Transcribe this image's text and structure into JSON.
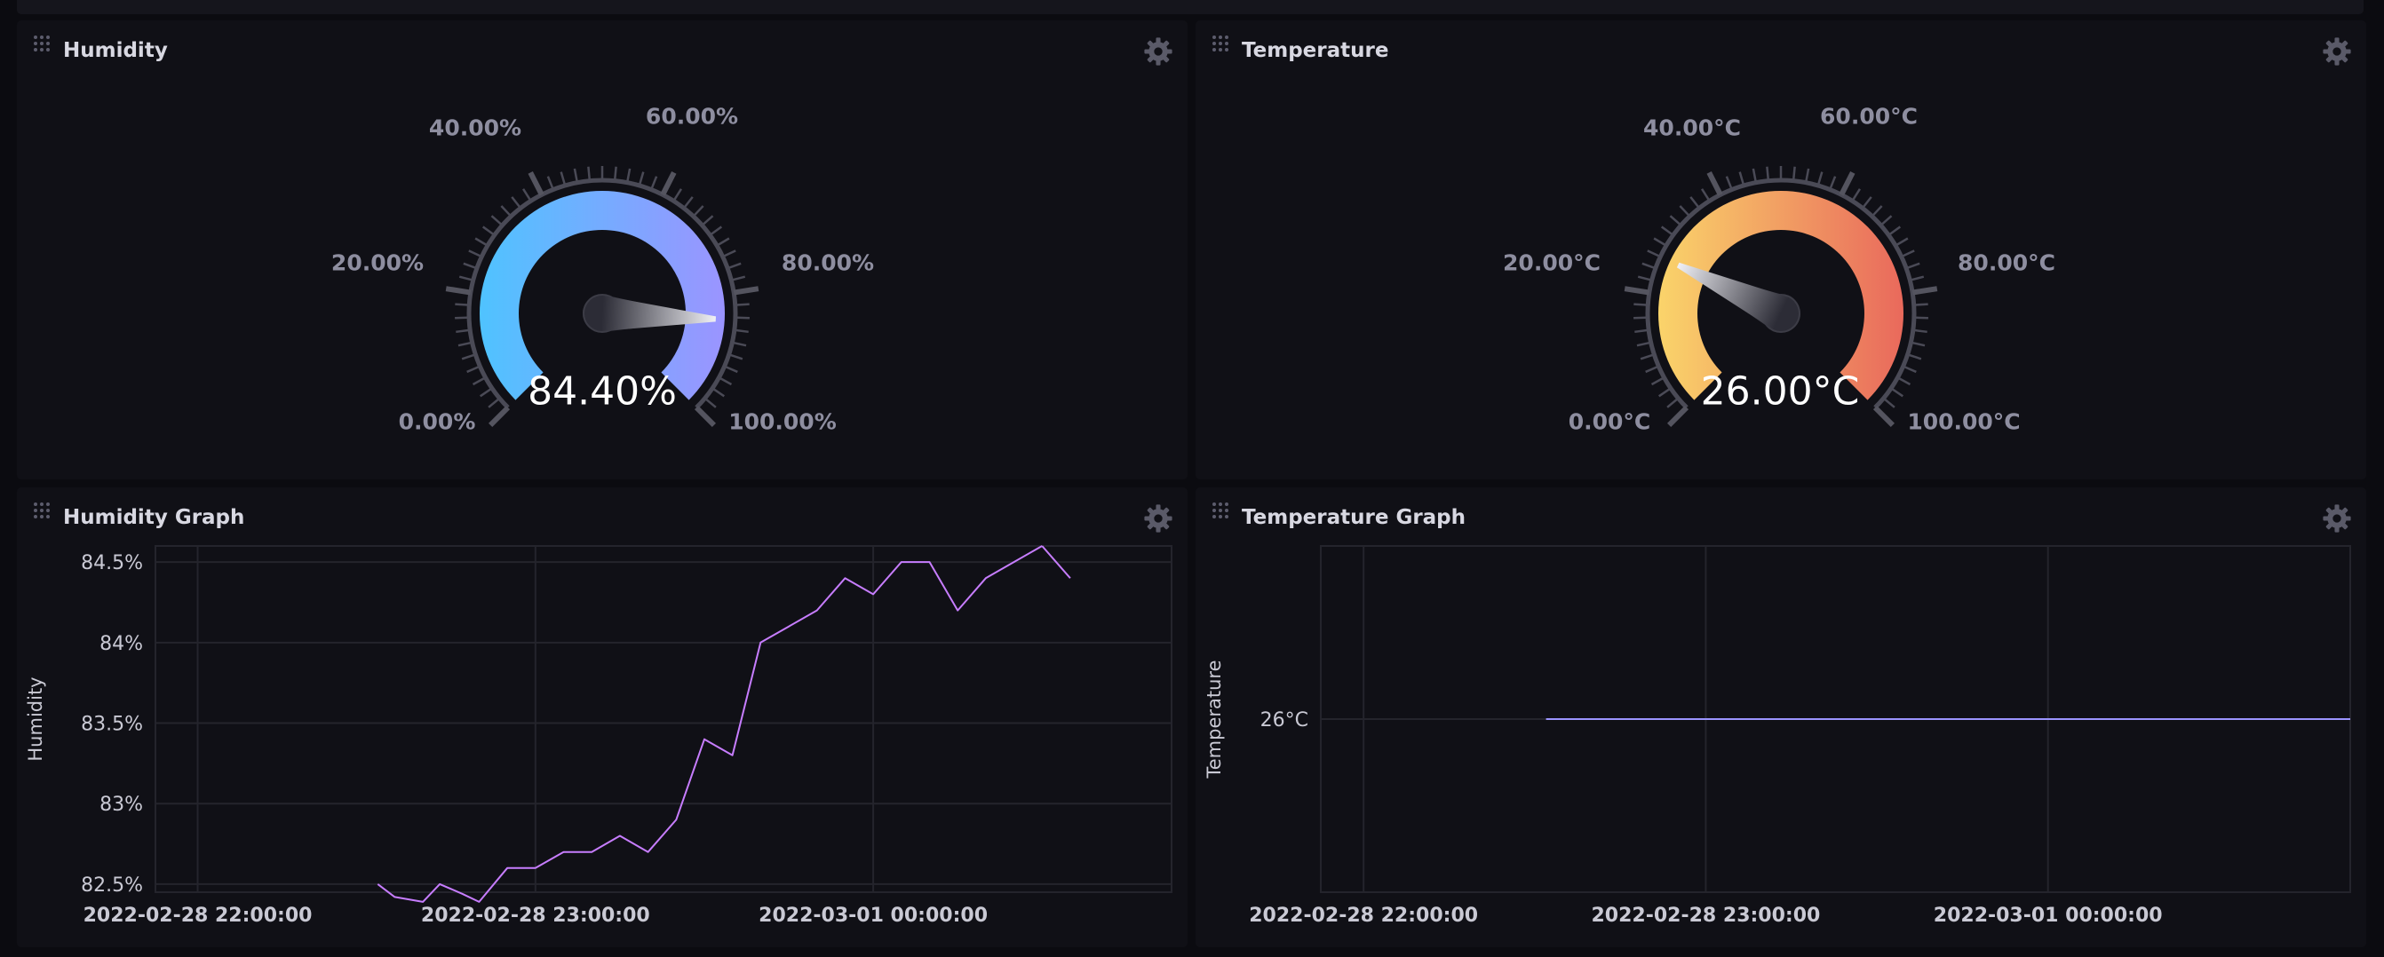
{
  "dashboard": {
    "cells": {
      "humidity_gauge": {
        "title": "Humidity",
        "value_text": "84.40%",
        "value": 84.4,
        "min": 0,
        "max": 100,
        "tick_labels": [
          "0.00%",
          "20.00%",
          "40.00%",
          "60.00%",
          "80.00%",
          "100.00%"
        ],
        "gradient": [
          "#4fc3ff",
          "#9b94ff"
        ]
      },
      "temperature_gauge": {
        "title": "Temperature",
        "value_text": "26.00°C",
        "value": 26.0,
        "min": 0,
        "max": 100,
        "tick_labels": [
          "0.00°C",
          "20.00°C",
          "40.00°C",
          "60.00°C",
          "80.00°C",
          "100.00°C"
        ],
        "gradient": [
          "#fad46a",
          "#e9695c"
        ]
      },
      "humidity_graph": {
        "title": "Humidity Graph",
        "ylabel": "Humidity",
        "y_ticks": [
          "84.5%",
          "84%",
          "83.5%",
          "83%",
          "82.5%"
        ],
        "x_ticks": [
          "2022-02-28 22:00:00",
          "2022-02-28 23:00:00",
          "2022-03-01 00:00:00"
        ]
      },
      "temperature_graph": {
        "title": "Temperature Graph",
        "ylabel": "Temperature",
        "y_ticks": [
          "26°C"
        ],
        "x_ticks": [
          "2022-02-28 22:00:00",
          "2022-02-28 23:00:00",
          "2022-03-01 00:00:00"
        ]
      }
    }
  },
  "chart_data": [
    {
      "type": "line",
      "title": "Humidity Graph",
      "xlabel": "",
      "ylabel": "Humidity",
      "xlim": [
        "2022-02-28 21:52:30",
        "2022-03-01 00:53:00"
      ],
      "ylim": [
        82.45,
        84.6
      ],
      "color": "#c77dff",
      "series": [
        {
          "x": [
            "2022-02-28 22:32:00",
            "2022-02-28 22:35:00",
            "2022-02-28 22:40:00",
            "2022-02-28 22:43:00",
            "2022-02-28 22:47:00",
            "2022-02-28 22:50:00",
            "2022-02-28 22:55:00",
            "2022-02-28 23:00:00",
            "2022-02-28 23:05:00",
            "2022-02-28 23:10:00",
            "2022-02-28 23:15:00",
            "2022-02-28 23:20:00",
            "2022-02-28 23:25:00",
            "2022-02-28 23:30:00",
            "2022-02-28 23:35:00",
            "2022-02-28 23:40:00",
            "2022-02-28 23:45:00",
            "2022-02-28 23:50:00",
            "2022-02-28 23:55:00",
            "2022-03-01 00:00:00",
            "2022-03-01 00:05:00",
            "2022-03-01 00:10:00",
            "2022-03-01 00:15:00",
            "2022-03-01 00:20:00",
            "2022-03-01 00:25:00",
            "2022-03-01 00:30:00"
          ],
          "values": [
            82.5,
            82.42,
            82.39,
            82.5,
            82.44,
            82.39,
            82.6,
            82.6,
            82.7,
            82.7,
            82.8,
            82.7,
            82.9,
            83.4,
            83.3,
            84.0,
            84.1,
            84.2,
            84.4,
            84.3,
            84.5,
            84.5,
            84.2,
            84.4,
            84.5,
            84.6
          ]
        },
        {
          "x": [
            "2022-03-01 00:35:00"
          ],
          "values": [
            84.4
          ]
        }
      ],
      "x_ticks": [
        "2022-02-28 22:00:00",
        "2022-02-28 23:00:00",
        "2022-03-01 00:00:00"
      ],
      "y_ticks": [
        84.5,
        84,
        83.5,
        83,
        82.5
      ]
    },
    {
      "type": "line",
      "title": "Temperature Graph",
      "xlabel": "",
      "ylabel": "Temperature",
      "xlim": [
        "2022-02-28 21:52:30",
        "2022-03-01 00:53:00"
      ],
      "color": "#9b94ff",
      "series": [
        {
          "x": [
            "2022-02-28 22:32:00",
            "2022-03-01 00:53:00"
          ],
          "values": [
            26,
            26
          ]
        }
      ],
      "x_ticks": [
        "2022-02-28 22:00:00",
        "2022-02-28 23:00:00",
        "2022-03-01 00:00:00"
      ],
      "y_ticks": [
        26
      ]
    }
  ]
}
